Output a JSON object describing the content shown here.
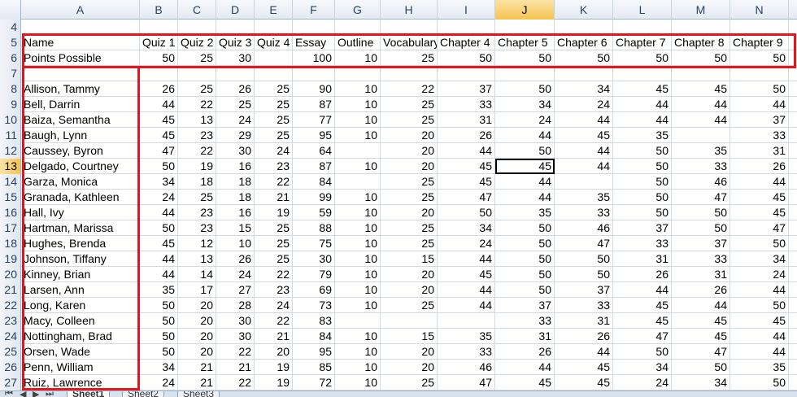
{
  "columns": [
    "A",
    "B",
    "C",
    "D",
    "E",
    "F",
    "G",
    "H",
    "I",
    "J",
    "K",
    "L",
    "M",
    "N"
  ],
  "selected_column": "J",
  "selected_row": "13",
  "active_cell_value_col": "J",
  "rows": [
    {
      "num": "4",
      "cells": [
        "",
        "",
        "",
        "",
        "",
        "",
        "",
        "",
        "",
        "",
        "",
        "",
        "",
        ""
      ]
    },
    {
      "num": "5",
      "cells": [
        "Name",
        "Quiz 1",
        "Quiz 2",
        "Quiz 3",
        "Quiz 4",
        "Essay",
        "Outline",
        "Vocabulary",
        "Chapter 4",
        "Chapter 5",
        "Chapter 6",
        "Chapter 7",
        "Chapter 8",
        "Chapter 9"
      ]
    },
    {
      "num": "6",
      "cells": [
        "Points Possible",
        "50",
        "25",
        "30",
        "",
        "100",
        "10",
        "25",
        "50",
        "50",
        "50",
        "50",
        "50",
        "50"
      ]
    },
    {
      "num": "7",
      "cells": [
        "",
        "",
        "",
        "",
        "",
        "",
        "",
        "",
        "",
        "",
        "",
        "",
        "",
        ""
      ]
    },
    {
      "num": "8",
      "cells": [
        "Allison, Tammy",
        "26",
        "25",
        "26",
        "25",
        "90",
        "10",
        "22",
        "37",
        "50",
        "34",
        "45",
        "45",
        "50"
      ]
    },
    {
      "num": "9",
      "cells": [
        "Bell, Darrin",
        "44",
        "22",
        "25",
        "25",
        "87",
        "10",
        "25",
        "33",
        "34",
        "24",
        "44",
        "44",
        "44"
      ]
    },
    {
      "num": "10",
      "cells": [
        "Baiza, Semantha",
        "45",
        "13",
        "24",
        "25",
        "77",
        "10",
        "25",
        "31",
        "24",
        "44",
        "44",
        "44",
        "37"
      ]
    },
    {
      "num": "11",
      "cells": [
        "Baugh, Lynn",
        "45",
        "23",
        "29",
        "25",
        "95",
        "10",
        "20",
        "26",
        "44",
        "45",
        "35",
        "",
        "33"
      ]
    },
    {
      "num": "12",
      "cells": [
        "Caussey, Byron",
        "47",
        "22",
        "30",
        "24",
        "64",
        "",
        "20",
        "44",
        "50",
        "44",
        "50",
        "35",
        "31"
      ]
    },
    {
      "num": "13",
      "cells": [
        "Delgado, Courtney",
        "50",
        "19",
        "16",
        "23",
        "87",
        "10",
        "20",
        "45",
        "45",
        "44",
        "50",
        "33",
        "26"
      ]
    },
    {
      "num": "14",
      "cells": [
        "Garza, Monica",
        "34",
        "18",
        "18",
        "22",
        "84",
        "",
        "25",
        "45",
        "44",
        "",
        "50",
        "46",
        "44"
      ]
    },
    {
      "num": "15",
      "cells": [
        "Granada, Kathleen",
        "24",
        "25",
        "18",
        "21",
        "99",
        "10",
        "25",
        "47",
        "44",
        "35",
        "50",
        "47",
        "45"
      ]
    },
    {
      "num": "16",
      "cells": [
        "Hall, Ivy",
        "44",
        "23",
        "16",
        "19",
        "59",
        "10",
        "20",
        "50",
        "35",
        "33",
        "50",
        "50",
        "45"
      ]
    },
    {
      "num": "17",
      "cells": [
        "Hartman, Marissa",
        "50",
        "23",
        "15",
        "25",
        "88",
        "10",
        "25",
        "34",
        "50",
        "46",
        "37",
        "50",
        "47"
      ]
    },
    {
      "num": "18",
      "cells": [
        "Hughes, Brenda",
        "45",
        "12",
        "10",
        "25",
        "75",
        "10",
        "25",
        "24",
        "50",
        "47",
        "33",
        "37",
        "50"
      ]
    },
    {
      "num": "19",
      "cells": [
        "Johnson, Tiffany",
        "44",
        "13",
        "26",
        "25",
        "30",
        "10",
        "15",
        "44",
        "50",
        "50",
        "31",
        "33",
        "34"
      ]
    },
    {
      "num": "20",
      "cells": [
        "Kinney, Brian",
        "44",
        "14",
        "24",
        "22",
        "79",
        "10",
        "20",
        "45",
        "50",
        "50",
        "26",
        "31",
        "24"
      ]
    },
    {
      "num": "21",
      "cells": [
        "Larsen, Ann",
        "35",
        "17",
        "27",
        "23",
        "69",
        "10",
        "20",
        "44",
        "50",
        "37",
        "44",
        "26",
        "44"
      ]
    },
    {
      "num": "22",
      "cells": [
        "Long, Karen",
        "50",
        "20",
        "28",
        "24",
        "73",
        "10",
        "25",
        "44",
        "37",
        "33",
        "45",
        "44",
        "50"
      ]
    },
    {
      "num": "23",
      "cells": [
        "Macy, Colleen",
        "50",
        "20",
        "30",
        "22",
        "83",
        "",
        "",
        "",
        "33",
        "31",
        "45",
        "45",
        "45"
      ]
    },
    {
      "num": "24",
      "cells": [
        "Nottingham, Brad",
        "50",
        "20",
        "30",
        "21",
        "84",
        "10",
        "15",
        "35",
        "31",
        "26",
        "47",
        "45",
        "44"
      ]
    },
    {
      "num": "25",
      "cells": [
        "Orsen, Wade",
        "50",
        "20",
        "22",
        "20",
        "95",
        "10",
        "20",
        "33",
        "26",
        "44",
        "50",
        "47",
        "44"
      ]
    },
    {
      "num": "26",
      "cells": [
        "Penn, William",
        "34",
        "21",
        "21",
        "19",
        "85",
        "10",
        "20",
        "46",
        "44",
        "45",
        "34",
        "50",
        "35"
      ]
    },
    {
      "num": "27",
      "cells": [
        "Ruiz, Lawrence",
        "24",
        "21",
        "22",
        "19",
        "72",
        "10",
        "25",
        "47",
        "45",
        "45",
        "24",
        "34",
        "50"
      ]
    }
  ],
  "tabs": [
    "Sheet1",
    "Sheet2",
    "Sheet3"
  ],
  "active_tab": "Sheet1",
  "colors": {
    "highlight_box": "#e8141c",
    "selected_header": "#f6c44f",
    "gridline": "#d0d7e5"
  }
}
